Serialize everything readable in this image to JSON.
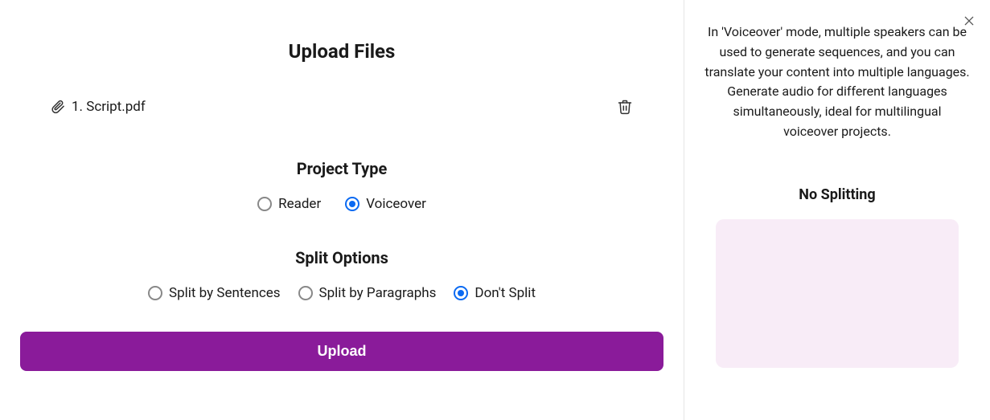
{
  "main": {
    "title": "Upload Files",
    "file": {
      "name": "1. Script.pdf"
    },
    "project_type": {
      "heading": "Project Type",
      "options": {
        "reader": "Reader",
        "voiceover": "Voiceover"
      },
      "selected": "voiceover"
    },
    "split_options": {
      "heading": "Split Options",
      "options": {
        "sentences": "Split by Sentences",
        "paragraphs": "Split by Paragraphs",
        "none": "Don't Split"
      },
      "selected": "none"
    },
    "upload_button": "Upload"
  },
  "side": {
    "info": "In 'Voiceover' mode, multiple speakers can be used to generate sequences, and you can translate your content into multiple languages. Generate audio for different languages simultaneously, ideal for multilingual voiceover projects.",
    "preview_heading": "No Splitting"
  }
}
